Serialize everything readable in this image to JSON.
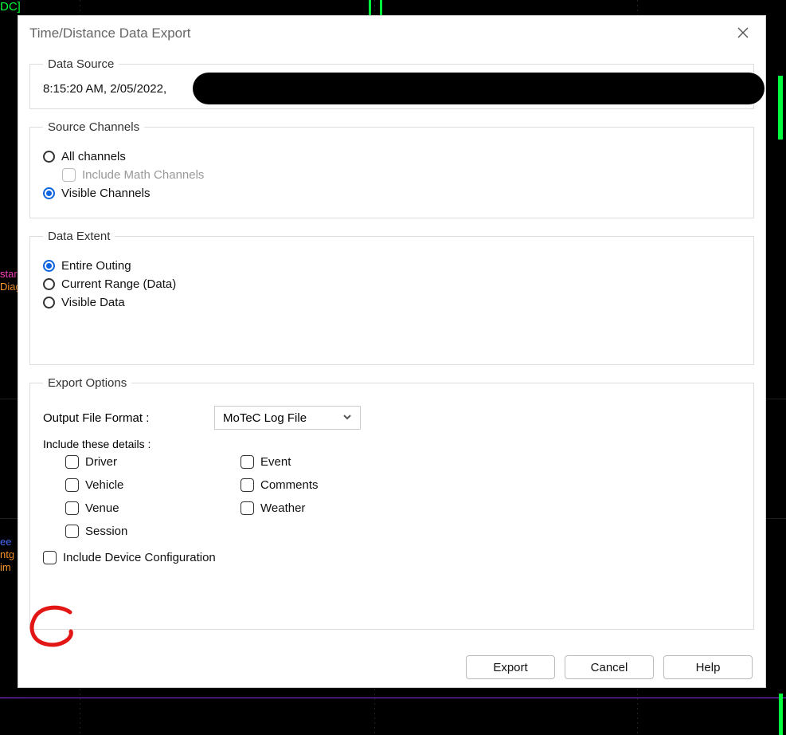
{
  "dialog": {
    "title": "Time/Distance Data Export"
  },
  "data_source": {
    "legend": "Data Source",
    "timestamp": "8:15:20 AM, 2/05/2022,"
  },
  "source_channels": {
    "legend": "Source Channels",
    "all": "All channels",
    "math": "Include Math Channels",
    "visible": "Visible Channels"
  },
  "data_extent": {
    "legend": "Data Extent",
    "entire": "Entire Outing",
    "current": "Current Range (Data)",
    "visible": "Visible Data"
  },
  "export_options": {
    "legend": "Export Options",
    "output_label": "Output File Format :",
    "output_value": "MoTeC Log File",
    "include_label": "Include these details :",
    "checks": {
      "driver": "Driver",
      "event": "Event",
      "vehicle": "Vehicle",
      "comments": "Comments",
      "venue": "Venue",
      "weather": "Weather",
      "session": "Session"
    },
    "device_config": "Include Device Configuration"
  },
  "buttons": {
    "export": "Export",
    "cancel": "Cancel",
    "help": "Help"
  },
  "bg_labels": {
    "top": "DC]",
    "l1a": "star",
    "l1b": "Diag",
    "l2a": "ee",
    "l2b": "ntg",
    "l2c": "im"
  }
}
